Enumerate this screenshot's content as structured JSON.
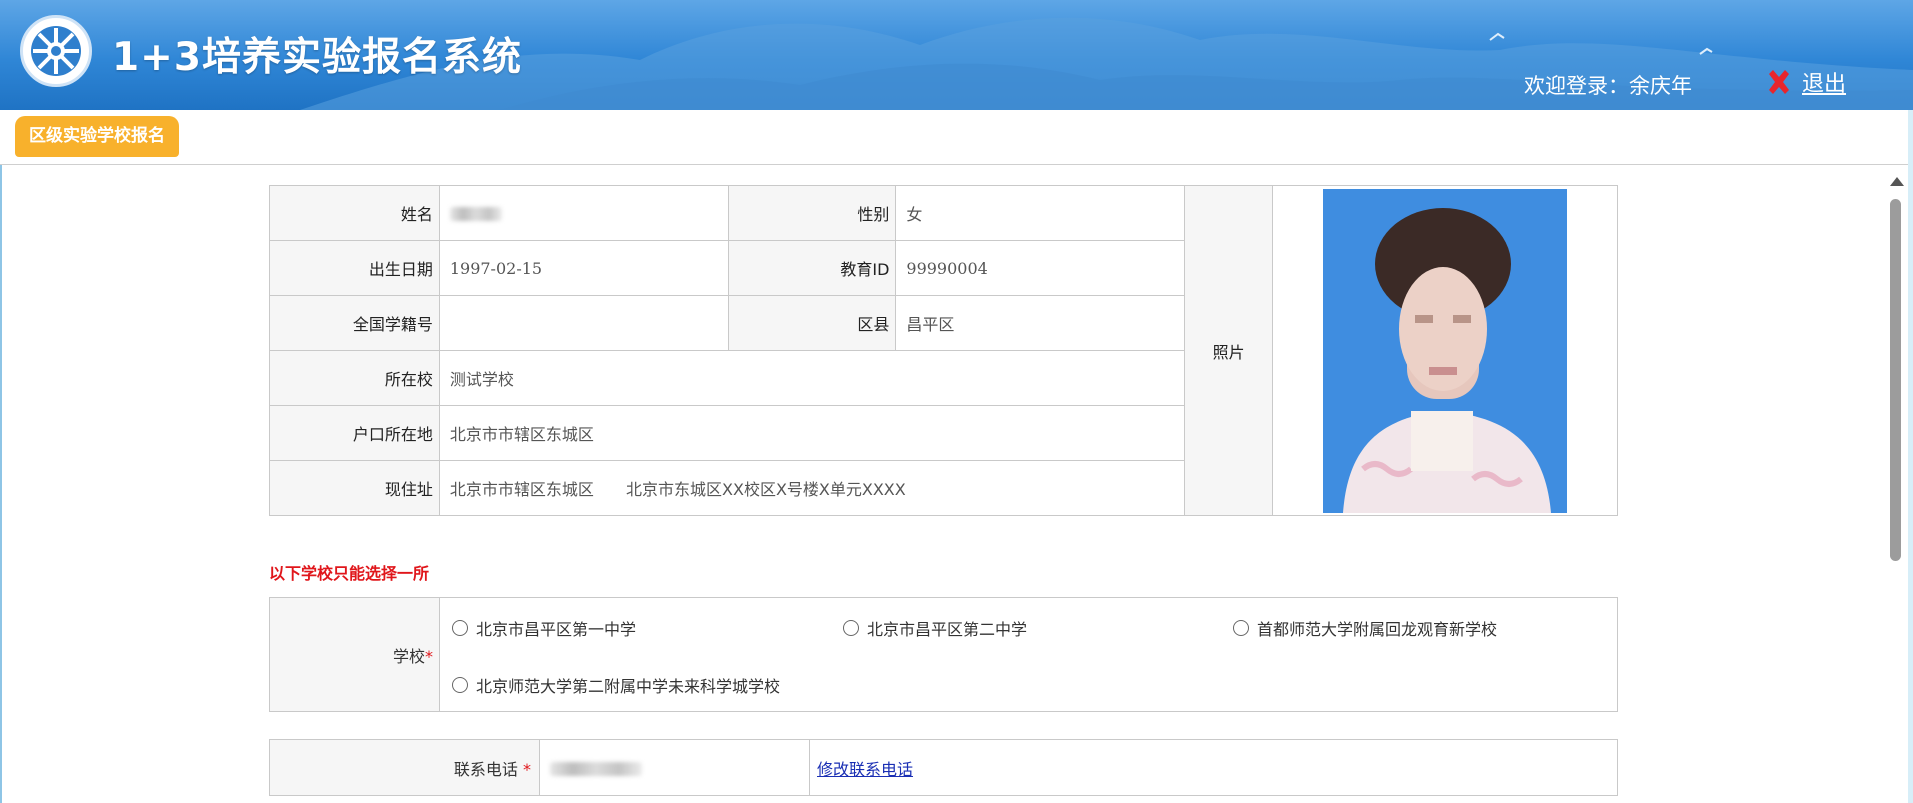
{
  "header": {
    "title": "1+3培养实验报名系统",
    "welcome": "欢迎登录：余庆年",
    "logout_label": "退出"
  },
  "tab": {
    "label": "区级实验学校报名"
  },
  "info": {
    "name_label": "姓名",
    "gender_label": "性别",
    "gender_value": "女",
    "birth_label": "出生日期",
    "birth_value": "1997-02-15",
    "edu_id_label": "教育ID",
    "edu_id_value": "99990004",
    "student_no_label": "全国学籍号",
    "student_no_value": "",
    "district_label": "区县",
    "district_value": "昌平区",
    "school_label": "所在校",
    "school_value": "测试学校",
    "hukou_label": "户口所在地",
    "hukou_value": "北京市市辖区东城区",
    "address_label": "现住址",
    "address_region": "北京市市辖区东城区",
    "address_detail": "北京市东城区XX校区X号楼X单元XXXX",
    "photo_label": "照片"
  },
  "notice": "以下学校只能选择一所",
  "school_select": {
    "label": "学校",
    "required_mark": "*",
    "options": [
      "北京市昌平区第一中学",
      "北京市昌平区第二中学",
      "首都师范大学附属回龙观育新学校",
      "北京师范大学第二附属中学未来科学城学校"
    ]
  },
  "contact": {
    "phone_label": "联系电话",
    "required_mark": "*",
    "edit_phone_link": "修改联系电话"
  },
  "colors": {
    "header_blue": "#2f86d6",
    "tab_orange": "#f8b12c",
    "notice_red": "#e0161b",
    "link_blue": "#1a2fb4"
  }
}
